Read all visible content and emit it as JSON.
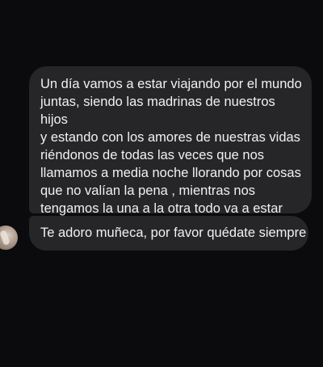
{
  "thread": {
    "messages": [
      {
        "text": "Un día vamos a estar viajando por el mundo\njuntas, siendo las madrinas de nuestros hijos\ny estando con los amores de nuestras vidas\nriéndonos de todas las veces que nos\nllamamos a media noche llorando por cosas\nque no valían la pena , mientras nos\ntengamos la una a la otra todo va a estar\nbien",
        "emoji": "heart-emoji"
      },
      {
        "text": "Te adoro muñeca, por favor quédate siempre"
      }
    ],
    "sender_avatar": "avatar-photo",
    "colors": {
      "background": "#0b0b0e",
      "bubble": "#262629",
      "text": "#f1f1f1",
      "heart": "#e0243a"
    }
  }
}
